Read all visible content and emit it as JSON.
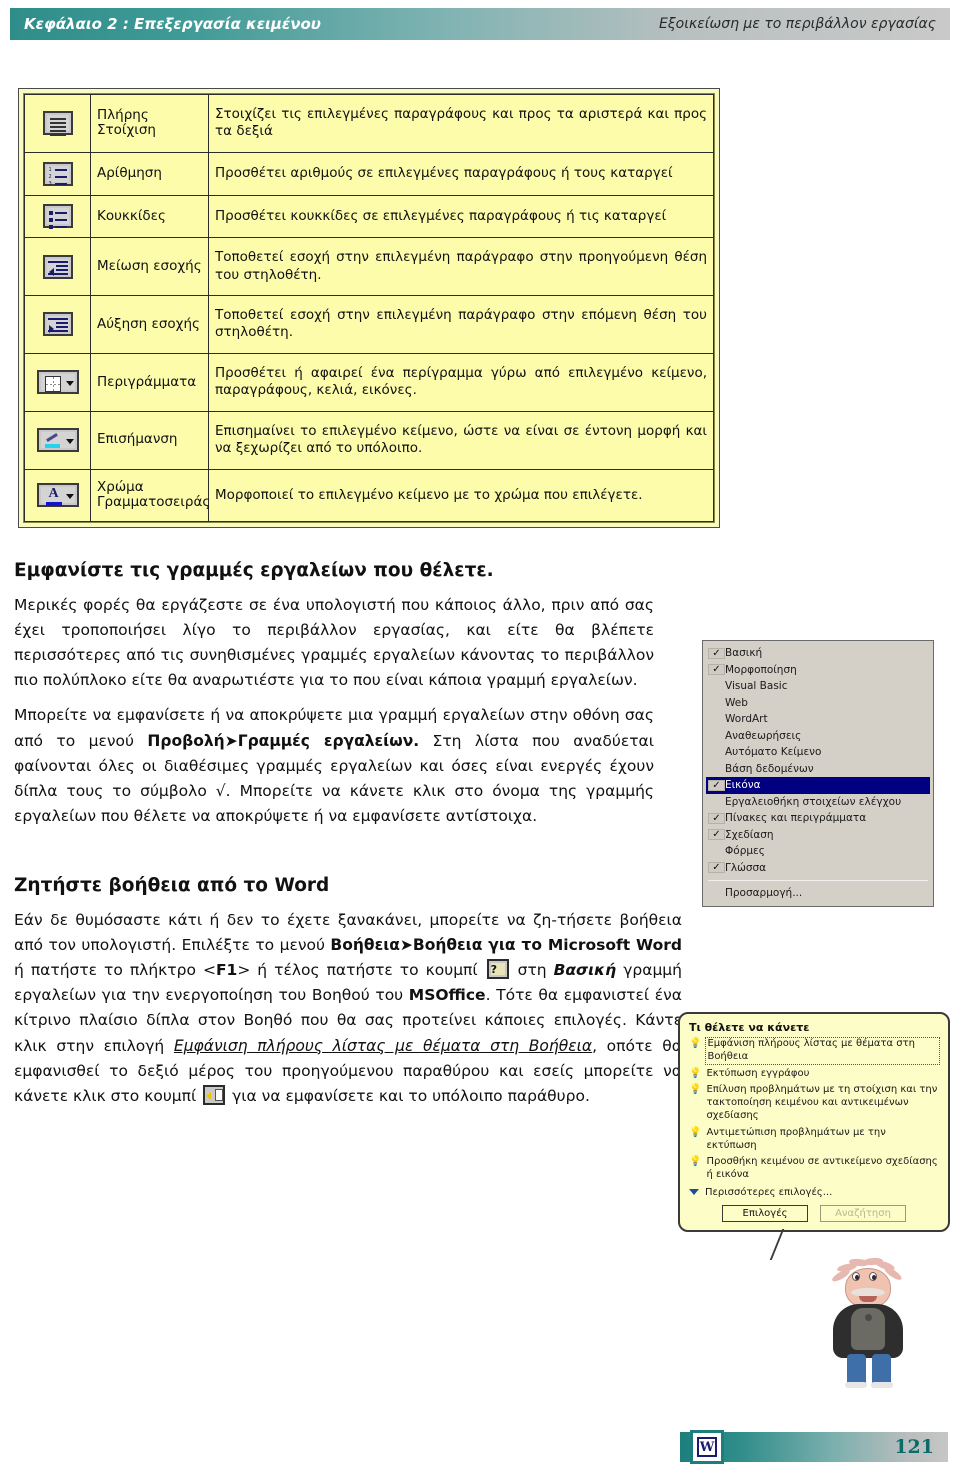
{
  "header": {
    "chapter": "Κεφάλαιο 2 : Επεξεργασία κειμένου",
    "section": "Εξοικείωση με το περιβάλλον εργασίας"
  },
  "icon_table": {
    "rows": [
      {
        "icon": "align-justify-icon",
        "name": "Πλήρης Στοίχιση",
        "description": "Στοιχίζει τις επιλεγμένες παραγράφους και προς τα αριστερά και προς τα δεξιά"
      },
      {
        "icon": "numbered-list-icon",
        "name": "Αρίθμηση",
        "description": "Προσθέτει αριθμούς σε επιλεγμένες παραγράφους ή τους καταργεί"
      },
      {
        "icon": "bulleted-list-icon",
        "name": "Κουκκίδες",
        "description": "Προσθέτει κουκκίδες σε επιλεγμένες παραγράφους ή τις καταργεί"
      },
      {
        "icon": "decrease-indent-icon",
        "name": "Μείωση εσοχής",
        "description": "Τοποθετεί εσοχή στην επιλεγμένη παράγραφο στην προηγούμενη θέση του στηλοθέτη."
      },
      {
        "icon": "increase-indent-icon",
        "name": "Αύξηση εσοχής",
        "description": "Τοποθετεί εσοχή στην επιλεγμένη παράγραφο στην επόμενη θέση του στηλοθέτη."
      },
      {
        "icon": "borders-icon",
        "name": "Περιγράμματα",
        "description": "Προσθέτει ή αφαιρεί ένα περίγραμμα γύρω από επιλεγμένο κείμενο, παραγράφους, κελιά, εικόνες."
      },
      {
        "icon": "highlight-icon",
        "name": "Επισήμανση",
        "description": "Επισημαίνει το επιλεγμένο κείμενο, ώστε να είναι σε έντονη μορφή και να ξεχωρίζει από το υπόλοιπο."
      },
      {
        "icon": "font-color-icon",
        "name": "Χρώμα Γραμματοσειράς",
        "description": "Μορφοποιεί το επιλεγμένο κείμενο με το χρώμα που επιλέγετε."
      }
    ]
  },
  "section_toolbars": {
    "heading": "Εμφανίστε τις γραμμές εργαλείων που θέλετε.",
    "paragraph1": "Μερικές φορές θα εργάζεστε σε ένα υπολογιστή που κάποιος άλλο, πριν από σας έχει τροποποιήσει λίγο το περιβάλλον εργασίας, και είτε θα βλέπετε περισσότερες από τις συνηθισμένες γραμμές εργαλείων κάνοντας το περιβάλλον πιο πολύπλοκο είτε θα αναρωτιέστε  για το που είναι κάποια γραμμή εργαλείων.",
    "p2_part1": "Μπορείτε να  εμφανίσετε ή να αποκρύψετε μια γραμμή εργαλείων στην οθόνη σας  από  το μενού ",
    "p2_menu": "Προβολή➤Γραμμές εργαλείων.",
    "p2_part2": " Στη λίστα που αναδύεται φαίνονται όλες οι διαθέσιμες γραμμές εργαλείων και όσες είναι ενεργές έχουν δίπλα τους το σύμβολο √. Μπορείτε να κάνετε κλικ στο όνομα της γραμμής εργαλείων που θέλετε να  αποκρύψετε ή να εμφανίσετε αντίστοιχα."
  },
  "toolbars_menu": {
    "items": [
      {
        "label": "Βασική",
        "checked": true,
        "selected": false
      },
      {
        "label": "Μορφοποίηση",
        "checked": true,
        "selected": false
      },
      {
        "label": "Visual Basic",
        "checked": false,
        "selected": false
      },
      {
        "label": "Web",
        "checked": false,
        "selected": false
      },
      {
        "label": "WordArt",
        "checked": false,
        "selected": false
      },
      {
        "label": "Αναθεωρήσεις",
        "checked": false,
        "selected": false
      },
      {
        "label": "Αυτόματο Κείμενο",
        "checked": false,
        "selected": false
      },
      {
        "label": "Βάση δεδομένων",
        "checked": false,
        "selected": false
      },
      {
        "label": "Εικόνα",
        "checked": true,
        "selected": true
      },
      {
        "label": "Εργαλειοθήκη στοιχείων ελέγχου",
        "checked": false,
        "selected": false
      },
      {
        "label": "Πίνακες και περιγράμματα",
        "checked": true,
        "selected": false
      },
      {
        "label": "Σχεδίαση",
        "checked": true,
        "selected": false
      },
      {
        "label": "Φόρμες",
        "checked": false,
        "selected": false
      },
      {
        "label": "Γλώσσα",
        "checked": true,
        "selected": false
      }
    ],
    "customize": "Προσαρμογή...",
    "check_glyph": "✓"
  },
  "section_help": {
    "heading": "Ζητήστε βοήθεια από το Word",
    "p1_a": "Εάν δε θυμόσαστε κάτι ή δεν το έχετε ξανακάνει, μπορείτε να ζη-τήσετε βοήθεια από τον υπολογιστή. Επιλέξτε το μενού ",
    "p1_menu": "Βοήθεια➤",
    "p1_menu2": "Βοήθεια για το Microsoft Word",
    "p1_b": " ή πατήστε το πλήκτρο <",
    "p1_key": "F1",
    "p1_c": "> ή τέλος πατήστε το κουμπί ",
    "p1_d": " στη ",
    "p1_basic": "Βασική",
    "p1_e": " γραμμή εργαλείων για την ενεργοποίηση του Βοηθού του ",
    "p1_msoffice": "MSOffice",
    "p1_f": ". Τότε θα εμφανιστεί ένα κίτρινο πλαίσιο δίπλα στον Βοηθό που θα σας προτείνει κάποιες επιλογές. Κάντε κλικ στην επιλογή ",
    "p1_link": "Εμφάνιση πλήρους λίστας με θέματα στη Βοήθεια",
    "p1_g": ", οπότε θα εμφανισθεί το δεξιό μέρος του προηγούμενου παραθύρου και εσείς μπορείτε να κάνετε κλικ στο κουμπί ",
    "p1_h": " για να εμφανίσετε και το υπόλοιπο παράθυρο."
  },
  "assistant_balloon": {
    "title": "Τι θέλετε να κάνετε",
    "options": [
      "Εμφάνιση πλήρους λίστας με θέματα στη Βοήθεια",
      "Εκτύπωση εγγράφου",
      "Επίλυση προβλημάτων με τη στοίχιση και την τακτοποίηση κειμένου και αντικειμένων σχεδίασης",
      "Αντιμετώπιση προβλημάτων με την εκτύπωση",
      "Προσθήκη κειμένου σε αντικείμενο σχεδίασης ή εικόνα"
    ],
    "more": "Περισσότερες επιλογές...",
    "button_options": "Επιλογές",
    "button_search": "Αναζήτηση",
    "bulb_glyph": "💡"
  },
  "footer": {
    "page": "121",
    "word_letter": "W"
  },
  "colors": {
    "header_teal": "#2f8d8a",
    "table_yellow": "#fcfcaa",
    "menu_selection": "#000080",
    "balloon_yellow": "#fdfdc8"
  }
}
